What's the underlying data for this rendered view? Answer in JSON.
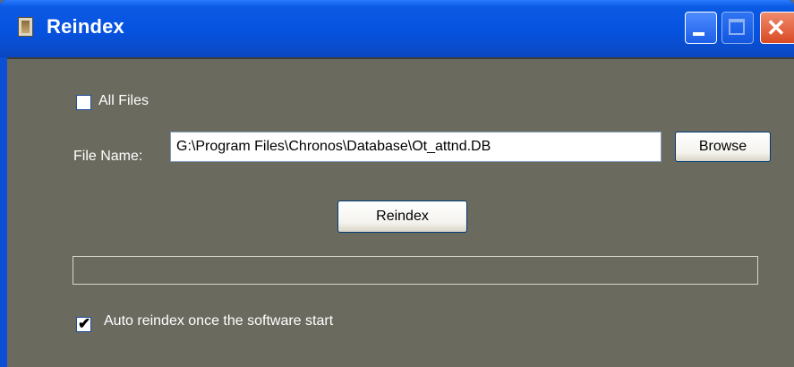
{
  "window": {
    "title": "Reindex",
    "icon": "hourglass-icon"
  },
  "controls": {
    "minimize": "minimize-icon",
    "maximize": "maximize-icon",
    "close": "close-icon",
    "close_glyph": "✕"
  },
  "all_files": {
    "label": "All Files",
    "checked": false
  },
  "file_name": {
    "label": "File Name:",
    "value": "G:\\Program Files\\Chronos\\Database\\Ot_attnd.DB"
  },
  "browse_label": "Browse",
  "reindex_label": "Reindex",
  "progress": {
    "value": 0
  },
  "auto_reindex": {
    "label": "Auto reindex once the software start",
    "checked": true,
    "check_glyph": "✔"
  },
  "colors": {
    "title_bar": "#0a55e0",
    "client_bg": "#6b6a5f",
    "label_text": "#ffffff"
  }
}
